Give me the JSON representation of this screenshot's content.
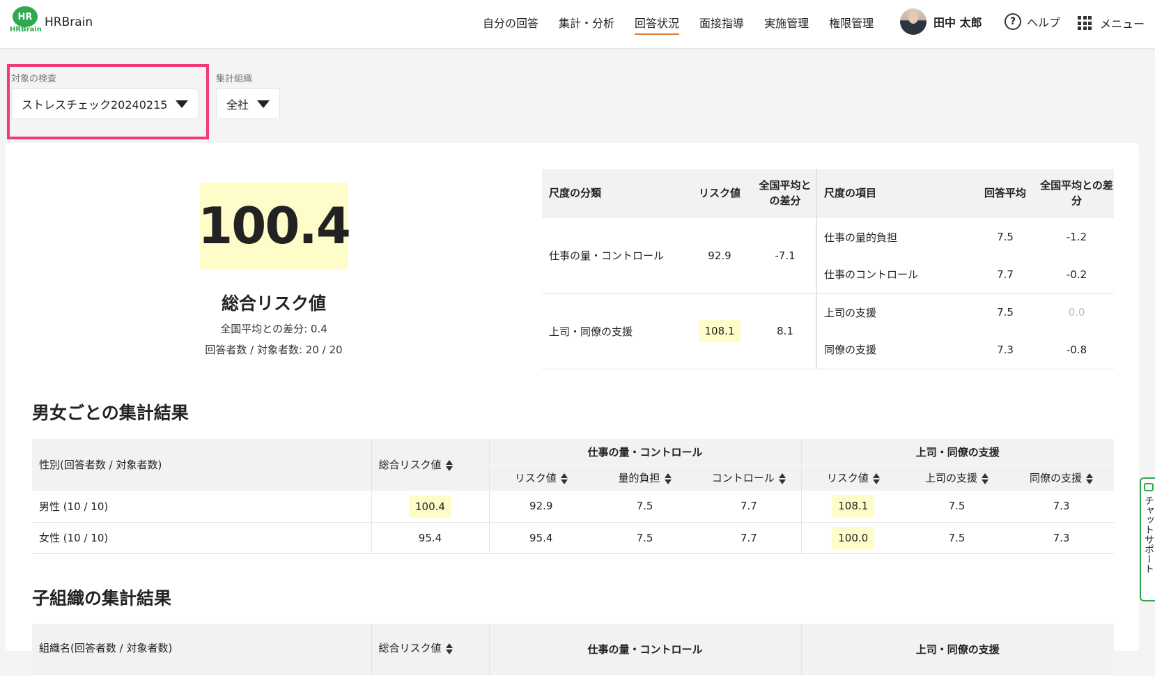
{
  "header": {
    "logo_text": "HR",
    "logo_sub": "HRBrain",
    "brand": "HRBrain",
    "nav": [
      "自分の回答",
      "集計・分析",
      "回答状況",
      "面接指導",
      "実施管理",
      "権限管理"
    ],
    "active_nav": "回答状況",
    "user_name": "田中 太郎",
    "help_label": "ヘルプ",
    "menu_label": "メニュー"
  },
  "filters": {
    "exam_label": "対象の検査",
    "exam_value": "ストレスチェック20240215",
    "org_label": "集計組織",
    "org_value": "全社"
  },
  "summary": {
    "total_risk": "100.4",
    "title": "総合リスク値",
    "national_diff": "全国平均との差分: 0.4",
    "respondents": "回答者数 / 対象者数: 20 / 20"
  },
  "scale_table": {
    "headers": [
      "尺度の分類",
      "リスク値",
      "全国平均との差分",
      "尺度の項目",
      "回答平均",
      "全国平均との差分"
    ],
    "groups": [
      {
        "category": "仕事の量・コントロール",
        "risk": "92.9",
        "diff": "-7.1",
        "items": [
          {
            "name": "仕事の量的負担",
            "avg": "7.5",
            "diff": "-1.2"
          },
          {
            "name": "仕事のコントロール",
            "avg": "7.7",
            "diff": "-0.2"
          }
        ]
      },
      {
        "category": "上司・同僚の支援",
        "risk": "108.1",
        "diff": "8.1",
        "items": [
          {
            "name": "上司の支援",
            "avg": "7.5",
            "diff": "0.0"
          },
          {
            "name": "同僚の支援",
            "avg": "7.3",
            "diff": "-0.8"
          }
        ]
      }
    ]
  },
  "gender_section": {
    "title": "男女ごとの集計結果",
    "headers": {
      "row_label": "性別(回答者数 / 対象者数)",
      "total": "総合リスク値",
      "group1": "仕事の量・コントロール",
      "group2": "上司・同僚の支援",
      "sub": [
        "リスク値",
        "量的負担",
        "コントロール",
        "リスク値",
        "上司の支援",
        "同僚の支援"
      ]
    },
    "rows": [
      {
        "label": "男性 (10 / 10)",
        "values": [
          "100.4",
          "92.9",
          "7.5",
          "7.7",
          "108.1",
          "7.5",
          "7.3"
        ]
      },
      {
        "label": "女性 (10 / 10)",
        "values": [
          "95.4",
          "95.4",
          "7.5",
          "7.7",
          "100.0",
          "7.5",
          "7.3"
        ]
      }
    ]
  },
  "org_section": {
    "title": "子組織の集計結果",
    "headers": {
      "row_label": "組織名(回答者数 / 対象者数)",
      "total": "総合リスク値",
      "group1": "仕事の量・コントロール",
      "group2": "上司・同僚の支援"
    }
  },
  "chat_support": "チャットサポート"
}
